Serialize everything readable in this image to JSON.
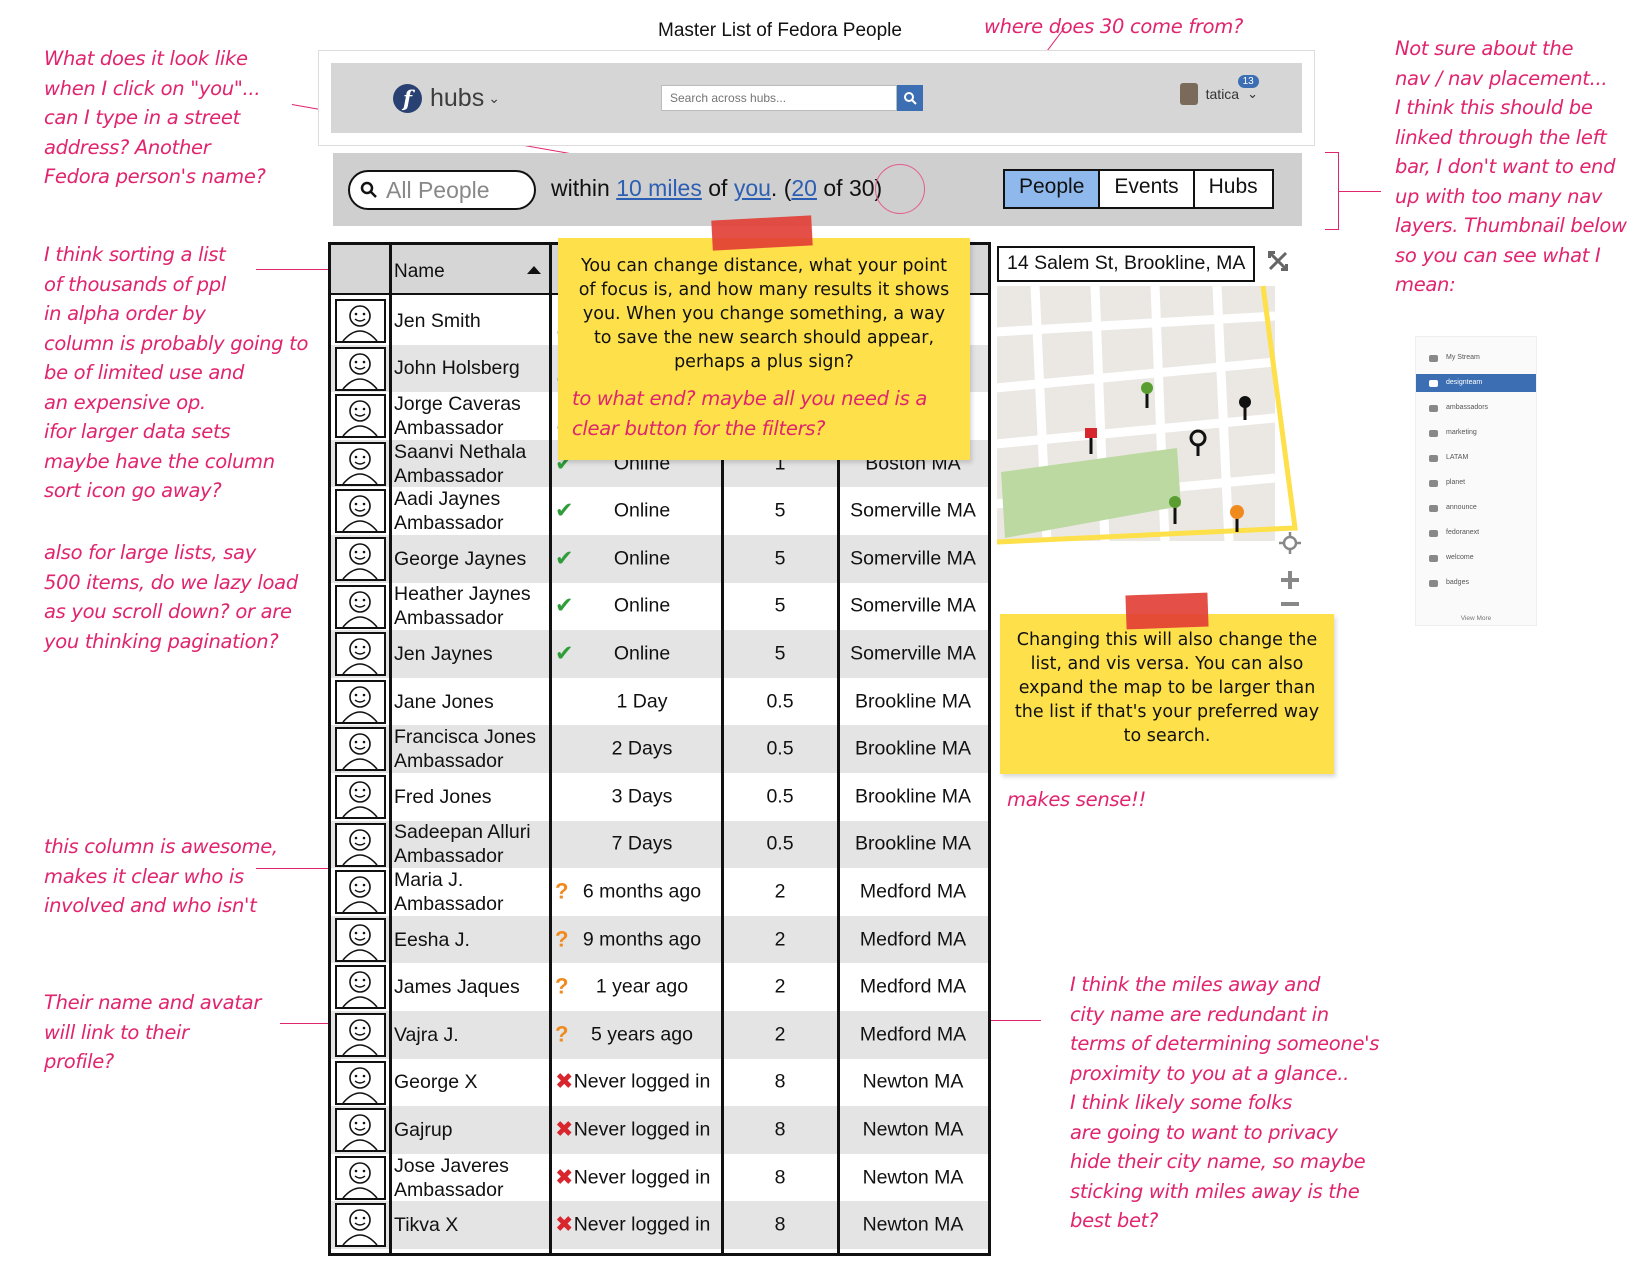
{
  "page_title": "Master List of Fedora People",
  "header": {
    "brand": "hubs",
    "search_placeholder": "Search across hubs...",
    "user_name": "tatica",
    "notification_count": "13"
  },
  "filter": {
    "search_text": "All People",
    "prefix": "within",
    "distance": "10 miles",
    "of_word": "of",
    "focus": "you",
    "open_paren": ". (",
    "shown": "20",
    "of_word2": "of",
    "total": "30",
    "close_paren": ")"
  },
  "tabs": [
    "People",
    "Events",
    "Hubs"
  ],
  "table": {
    "header_name": "Name",
    "rows": [
      {
        "name": "Jen Smith",
        "status": "",
        "icon": "check",
        "miles": "",
        "city": ""
      },
      {
        "name": "John Holsberg",
        "status": "",
        "icon": "check",
        "miles": "",
        "city": ""
      },
      {
        "name": "Jorge Caveras\nAmbassador",
        "status": "",
        "icon": "check",
        "miles": "",
        "city": ""
      },
      {
        "name": "Saanvi Nethala\nAmbassador",
        "status": "Online",
        "icon": "check",
        "miles": "1",
        "city": "Boston MA"
      },
      {
        "name": "Aadi Jaynes\nAmbassador",
        "status": "Online",
        "icon": "check",
        "miles": "5",
        "city": "Somerville MA"
      },
      {
        "name": "George Jaynes",
        "status": "Online",
        "icon": "check",
        "miles": "5",
        "city": "Somerville MA"
      },
      {
        "name": "Heather Jaynes\nAmbassador",
        "status": "Online",
        "icon": "check",
        "miles": "5",
        "city": "Somerville MA"
      },
      {
        "name": "Jen Jaynes",
        "status": "Online",
        "icon": "check",
        "miles": "5",
        "city": "Somerville MA"
      },
      {
        "name": "Jane Jones",
        "status": "1 Day",
        "icon": "",
        "miles": "0.5",
        "city": "Brookline MA"
      },
      {
        "name": "Francisca Jones\nAmbassador",
        "status": "2 Days",
        "icon": "",
        "miles": "0.5",
        "city": "Brookline MA"
      },
      {
        "name": "Fred Jones",
        "status": "3 Days",
        "icon": "",
        "miles": "0.5",
        "city": "Brookline MA"
      },
      {
        "name": "Sadeepan Alluri\nAmbassador",
        "status": "7 Days",
        "icon": "",
        "miles": "0.5",
        "city": "Brookline MA"
      },
      {
        "name": "Maria J.\nAmbassador",
        "status": "6 months ago",
        "icon": "question",
        "miles": "2",
        "city": "Medford MA"
      },
      {
        "name": "Eesha J.",
        "status": "9 months ago",
        "icon": "question",
        "miles": "2",
        "city": "Medford MA"
      },
      {
        "name": "James Jaques",
        "status": "1 year ago",
        "icon": "question",
        "miles": "2",
        "city": "Medford MA"
      },
      {
        "name": "Vajra J.",
        "status": "5 years ago",
        "icon": "question",
        "miles": "2",
        "city": "Medford MA"
      },
      {
        "name": "George X",
        "status": "Never logged in",
        "icon": "cross",
        "miles": "8",
        "city": "Newton MA"
      },
      {
        "name": "Gajrup",
        "status": "Never logged in",
        "icon": "cross",
        "miles": "8",
        "city": "Newton MA"
      },
      {
        "name": "Jose Javeres\nAmbassador",
        "status": "Never logged in",
        "icon": "cross",
        "miles": "8",
        "city": "Newton MA"
      },
      {
        "name": "Tikva X",
        "status": "Never logged in",
        "icon": "cross",
        "miles": "8",
        "city": "Newton MA"
      }
    ]
  },
  "map": {
    "address": "14 Salem St, Brookline, MA"
  },
  "stickies": {
    "search_note": "You can change distance, what your point of focus is, and how many results it shows you. When you change something, a way to save the new search should appear, perhaps a plus sign?",
    "map_note": "Changing this will also change the list, and vis versa. You can also expand the map to be larger than the list if that's your preferred way to search."
  },
  "annotations": {
    "where_30": "where does 30 come from?",
    "click_you": "What does it look like\nwhen I click on \"you\"...\ncan I type in a street\naddress? Another\nFedora person's name?",
    "nav_placement": "Not sure about the\nnav / nav placement...\nI think this should be\nlinked through the left\nbar, I don't want to end\nup with too many nav\nlayers. Thumbnail below\nso you can see what I\nmean:",
    "sorting": "I think sorting a list\nof thousands of ppl\nin alpha order by\ncolumn is probably going to\nbe of limited use and\nan expensive op.\nifor larger data sets\nmaybe have the column\nsort icon go away?",
    "lazy_load": "also for large lists, say\n500 items, do we lazy load\nas you scroll down? or are\nyou thinking pagination?",
    "to_what_end": "to what end? maybe all you need is a\nclear button for the filters?",
    "makes_sense": "makes sense!!",
    "column_awesome": "this column is awesome,\nmakes it clear who is\ninvolved and who isn't",
    "name_link": "Their name and avatar\nwill link to their\nprofile?",
    "redundant": "I think the miles away and\ncity name are redundant in\nterms of determining someone's\nproximity to you at a glance..\nI think likely some folks\nare going to want to privacy\nhide their city name, so maybe\nsticking with miles away is the\nbest bet?"
  },
  "nav_thumbnail": {
    "items": [
      "My Stream",
      "designteam",
      "ambassadors",
      "marketing",
      "LATAM",
      "planet",
      "announce",
      "fedoranext",
      "welcome",
      "badges"
    ],
    "active": "designteam",
    "more": "View More"
  },
  "colors": {
    "annotation": "#e0246e",
    "sticky": "#fde04a",
    "tab_active": "#8fb8ec",
    "link": "#2c5fb3",
    "check": "#2f9e3a",
    "question": "#f08a1c",
    "cross": "#d8262f"
  }
}
